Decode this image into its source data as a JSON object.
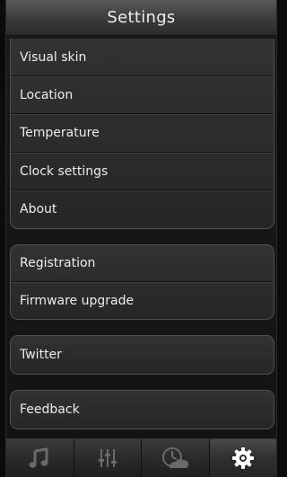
{
  "header": {
    "title": "Settings"
  },
  "groups": [
    {
      "items": [
        "Visual skin",
        "Location",
        "Temperature",
        "Clock settings",
        "About"
      ]
    },
    {
      "items": [
        "Registration",
        "Firmware upgrade"
      ]
    },
    {
      "items": [
        "Twitter"
      ]
    },
    {
      "items": [
        "Feedback"
      ]
    }
  ],
  "tabbar": {
    "tabs": [
      {
        "icon": "music-note-icon",
        "active": false
      },
      {
        "icon": "equalizer-sliders-icon",
        "active": false
      },
      {
        "icon": "weather-clock-icon",
        "active": false
      },
      {
        "icon": "gear-icon",
        "active": true
      }
    ]
  },
  "colors": {
    "text": "#ececec",
    "background": "#121212",
    "active_icon": "#ffffff",
    "inactive_icon": "#6a6a6a"
  }
}
